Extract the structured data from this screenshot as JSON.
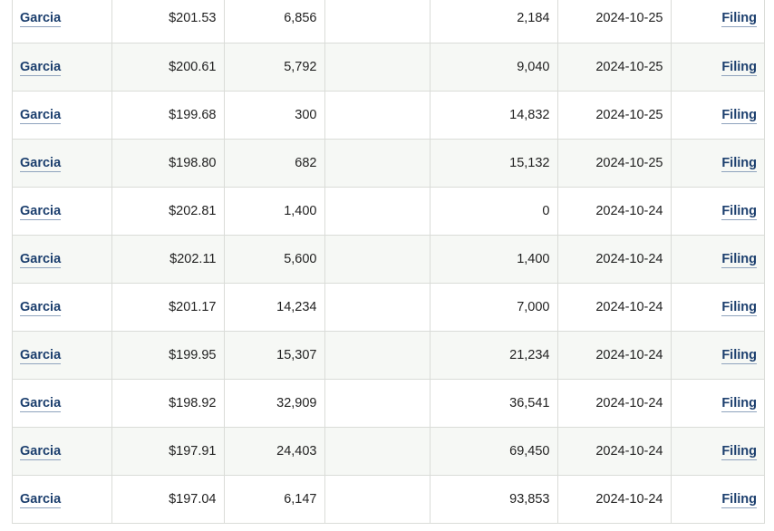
{
  "rows": [
    {
      "insider": "Garcia",
      "price": "$201.53",
      "qty": "6,856",
      "owned": "",
      "remaining": "2,184",
      "date": "2024-10-25",
      "link": "Filing"
    },
    {
      "insider": "Garcia",
      "price": "$200.61",
      "qty": "5,792",
      "owned": "",
      "remaining": "9,040",
      "date": "2024-10-25",
      "link": "Filing"
    },
    {
      "insider": "Garcia",
      "price": "$199.68",
      "qty": "300",
      "owned": "",
      "remaining": "14,832",
      "date": "2024-10-25",
      "link": "Filing"
    },
    {
      "insider": "Garcia",
      "price": "$198.80",
      "qty": "682",
      "owned": "",
      "remaining": "15,132",
      "date": "2024-10-25",
      "link": "Filing"
    },
    {
      "insider": "Garcia",
      "price": "$202.81",
      "qty": "1,400",
      "owned": "",
      "remaining": "0",
      "date": "2024-10-24",
      "link": "Filing"
    },
    {
      "insider": "Garcia",
      "price": "$202.11",
      "qty": "5,600",
      "owned": "",
      "remaining": "1,400",
      "date": "2024-10-24",
      "link": "Filing"
    },
    {
      "insider": "Garcia",
      "price": "$201.17",
      "qty": "14,234",
      "owned": "",
      "remaining": "7,000",
      "date": "2024-10-24",
      "link": "Filing"
    },
    {
      "insider": "Garcia",
      "price": "$199.95",
      "qty": "15,307",
      "owned": "",
      "remaining": "21,234",
      "date": "2024-10-24",
      "link": "Filing"
    },
    {
      "insider": "Garcia",
      "price": "$198.92",
      "qty": "32,909",
      "owned": "",
      "remaining": "36,541",
      "date": "2024-10-24",
      "link": "Filing"
    },
    {
      "insider": "Garcia",
      "price": "$197.91",
      "qty": "24,403",
      "owned": "",
      "remaining": "69,450",
      "date": "2024-10-24",
      "link": "Filing"
    },
    {
      "insider": "Garcia",
      "price": "$197.04",
      "qty": "6,147",
      "owned": "",
      "remaining": "93,853",
      "date": "2024-10-24",
      "link": "Filing"
    }
  ]
}
